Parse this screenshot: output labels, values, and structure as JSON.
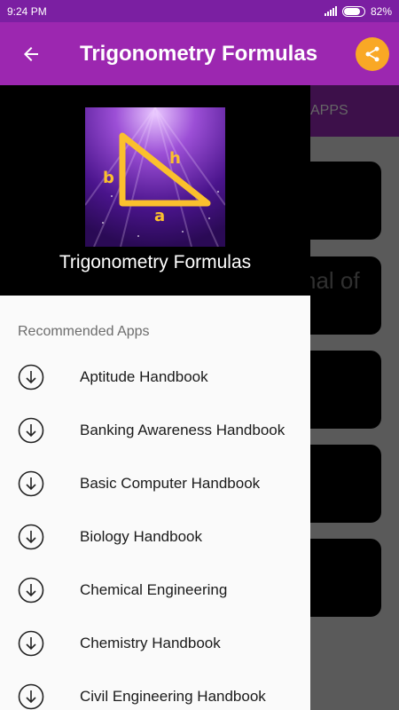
{
  "status_bar": {
    "time": "9:24 PM",
    "battery": "82%"
  },
  "app_bar": {
    "title": "Trigonometry Formulas"
  },
  "background": {
    "tab_label": "APPS",
    "card_fragments": [
      "nal of",
      "l"
    ]
  },
  "drawer": {
    "app_name": "Trigonometry Formulas",
    "logo_labels": {
      "b": "b",
      "h": "h",
      "a": "a"
    },
    "section_title": "Recommended Apps",
    "items": [
      {
        "label": "Aptitude Handbook",
        "icon": "download-circle-icon"
      },
      {
        "label": "Banking Awareness Handbook",
        "icon": "download-circle-icon"
      },
      {
        "label": "Basic Computer Handbook",
        "icon": "download-circle-icon"
      },
      {
        "label": "Biology Handbook",
        "icon": "download-circle-icon"
      },
      {
        "label": "Chemical Engineering",
        "icon": "download-circle-icon"
      },
      {
        "label": "Chemistry Handbook",
        "icon": "download-circle-icon"
      },
      {
        "label": "Civil Engineering Handbook",
        "icon": "download-circle-icon"
      }
    ]
  },
  "colors": {
    "primary": "#9c27b0",
    "primary_dark": "#7b1fa2",
    "accent": "#f9a825"
  }
}
